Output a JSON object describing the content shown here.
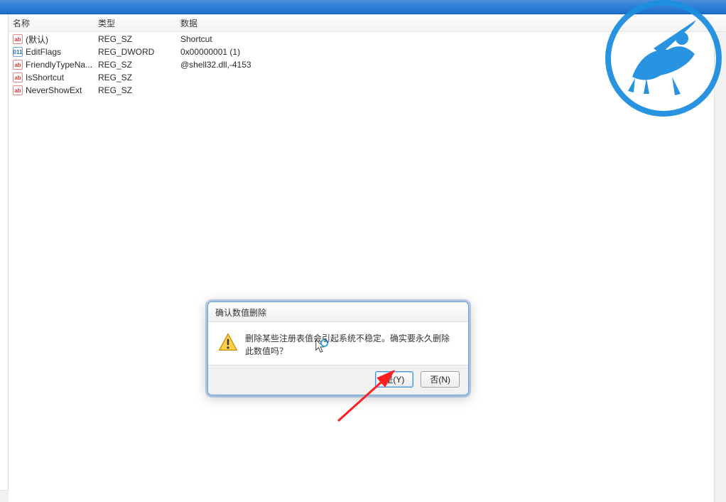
{
  "titlebar": {},
  "headers": {
    "name": "名称",
    "type": "类型",
    "data": "数据"
  },
  "rows": [
    {
      "icon": "string",
      "name": "(默认)",
      "type": "REG_SZ",
      "data": "Shortcut"
    },
    {
      "icon": "binary",
      "name": "EditFlags",
      "type": "REG_DWORD",
      "data": "0x00000001 (1)"
    },
    {
      "icon": "string",
      "name": "FriendlyTypeNa...",
      "type": "REG_SZ",
      "data": "@shell32.dll,-4153"
    },
    {
      "icon": "string",
      "name": "IsShortcut",
      "type": "REG_SZ",
      "data": ""
    },
    {
      "icon": "string",
      "name": "NeverShowExt",
      "type": "REG_SZ",
      "data": ""
    }
  ],
  "dialog": {
    "title": "确认数值删除",
    "message": "删除某些注册表值会引起系统不稳定。确实要永久删除此数值吗？",
    "yes": "是(Y)",
    "no": "否(N)"
  }
}
